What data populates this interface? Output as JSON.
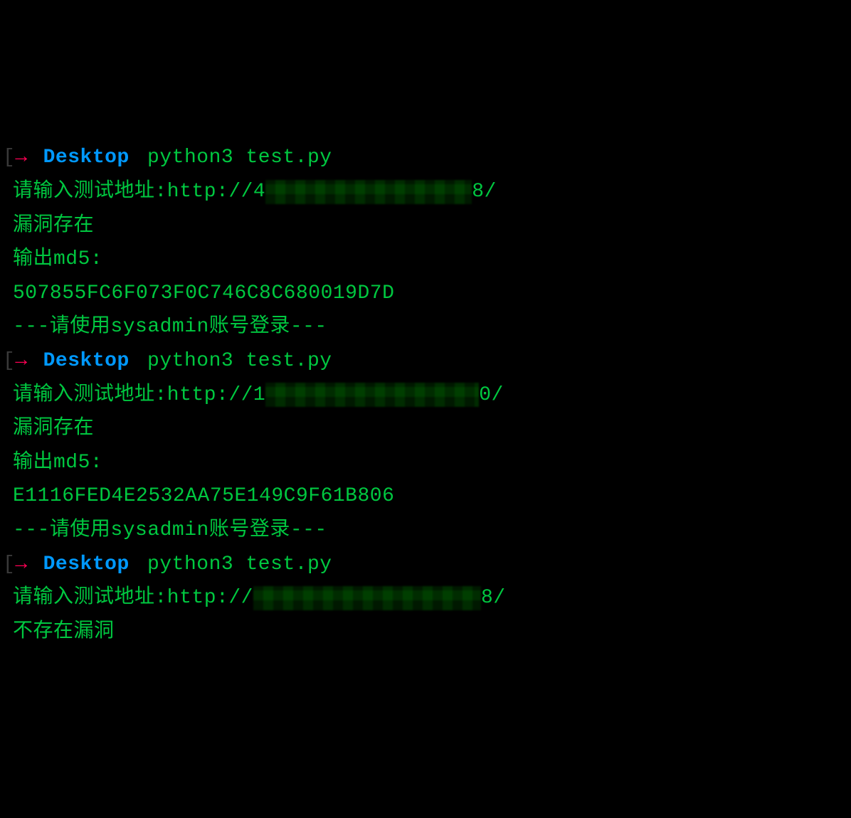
{
  "runs": [
    {
      "prompt": {
        "arrow": "→",
        "dir": "Desktop",
        "cmd": "python3 test.py"
      },
      "lines": [
        {
          "prefix": "请输入测试地址:http://4",
          "redacted_class": "redacted-1",
          "suffix": "8/"
        },
        "漏洞存在",
        "输出md5:",
        "507855FC6F073F0C746C8C680019D7D",
        "---请使用sysadmin账号登录---"
      ]
    },
    {
      "prompt": {
        "arrow": "→",
        "dir": "Desktop",
        "cmd": "python3 test.py"
      },
      "lines": [
        {
          "prefix": "请输入测试地址:http://1",
          "redacted_class": "redacted-2",
          "suffix": "0/"
        },
        "漏洞存在",
        "输出md5:",
        "E1116FED4E2532AA75E149C9F61B806",
        "---请使用sysadmin账号登录---"
      ]
    },
    {
      "prompt": {
        "arrow": "→",
        "dir": "Desktop",
        "cmd": "python3 test.py"
      },
      "lines": [
        {
          "prefix": "请输入测试地址:http://",
          "redacted_class": "redacted-3",
          "suffix": "8/"
        },
        "不存在漏洞"
      ]
    }
  ]
}
